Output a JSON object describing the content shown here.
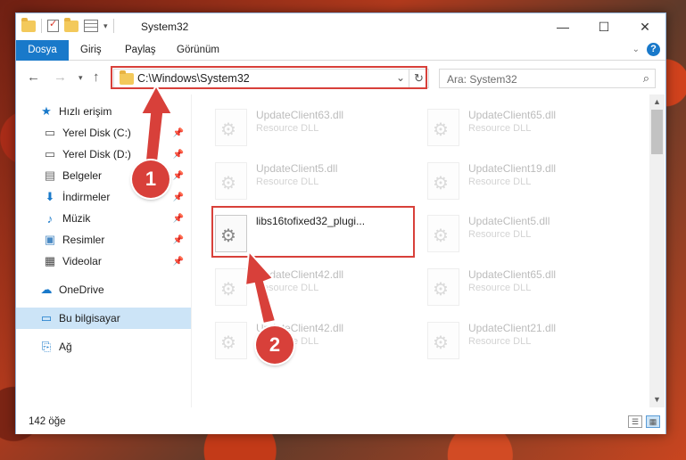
{
  "window": {
    "title": "System32"
  },
  "ribbon": {
    "tabs": [
      "Dosya",
      "Giriş",
      "Paylaş",
      "Görünüm"
    ]
  },
  "address": {
    "path": "C:\\Windows\\System32"
  },
  "search": {
    "placeholder": "Ara: System32"
  },
  "sidebar": {
    "quick_access": "Hızlı erişim",
    "items": [
      {
        "label": "Yerel Disk (C:)",
        "icon": "drive-icon",
        "pinned": true
      },
      {
        "label": "Yerel Disk (D:)",
        "icon": "drive-icon",
        "pinned": true
      },
      {
        "label": "Belgeler",
        "icon": "documents-icon",
        "pinned": true
      },
      {
        "label": "İndirmeler",
        "icon": "download-icon",
        "pinned": true
      },
      {
        "label": "Müzik",
        "icon": "music-icon",
        "pinned": true
      },
      {
        "label": "Resimler",
        "icon": "pictures-icon",
        "pinned": true
      },
      {
        "label": "Videolar",
        "icon": "videos-icon",
        "pinned": true
      }
    ],
    "onedrive": "OneDrive",
    "this_pc": "Bu bilgisayar",
    "network": "Ağ"
  },
  "files": [
    {
      "name": "UpdateClient63.dll",
      "type": "Resource DLL",
      "faded": true
    },
    {
      "name": "UpdateClient65.dll",
      "type": "Resource DLL",
      "faded": true
    },
    {
      "name": "UpdateClient5.dll",
      "type": "Resource DLL",
      "faded": true
    },
    {
      "name": "UpdateClient19.dll",
      "type": "Resource DLL",
      "faded": true
    },
    {
      "name": "libs16tofixed32_plugi...",
      "type": "",
      "faded": false
    },
    {
      "name": "UpdateClient5.dll",
      "type": "Resource DLL",
      "faded": true
    },
    {
      "name": "UpdateClient42.dll",
      "type": "Resource DLL",
      "faded": true
    },
    {
      "name": "UpdateClient65.dll",
      "type": "Resource DLL",
      "faded": true
    },
    {
      "name": "UpdateClient42.dll",
      "type": "Resource DLL",
      "faded": true
    },
    {
      "name": "UpdateClient21.dll",
      "type": "Resource DLL",
      "faded": true
    }
  ],
  "status": {
    "count": "142 öğe"
  },
  "annotations": {
    "step1": "1",
    "step2": "2"
  },
  "colors": {
    "accent": "#1979ca",
    "highlight": "#d8403a",
    "selected": "#cce4f7"
  }
}
